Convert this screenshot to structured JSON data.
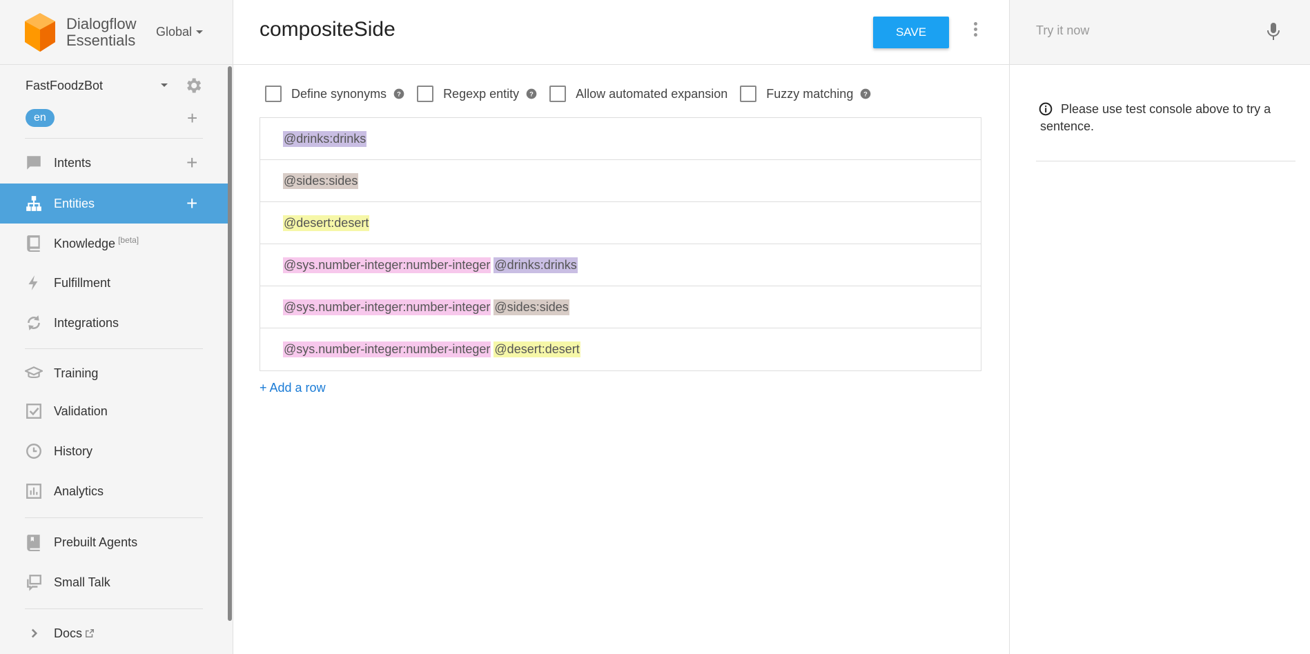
{
  "brand": {
    "line1": "Dialogflow",
    "line2": "Essentials",
    "region": "Global"
  },
  "agent": {
    "name": "FastFoodzBot",
    "language": "en"
  },
  "nav": {
    "intents": "Intents",
    "entities": "Entities",
    "knowledge": "Knowledge",
    "knowledge_tag": "[beta]",
    "fulfillment": "Fulfillment",
    "integrations": "Integrations",
    "training": "Training",
    "validation": "Validation",
    "history": "History",
    "analytics": "Analytics",
    "prebuilt": "Prebuilt Agents",
    "smalltalk": "Small Talk",
    "docs": "Docs"
  },
  "entity": {
    "name": "compositeSide",
    "save_label": "SAVE"
  },
  "options": {
    "define_synonyms": "Define synonyms",
    "regexp": "Regexp entity",
    "automated_expansion": "Allow automated expansion",
    "fuzzy": "Fuzzy matching"
  },
  "rows": [
    [
      {
        "text": "@drinks:drinks",
        "type": "drinks"
      }
    ],
    [
      {
        "text": "@sides:sides",
        "type": "sides"
      }
    ],
    [
      {
        "text": "@desert:desert",
        "type": "desert"
      }
    ],
    [
      {
        "text": "@sys.number-integer:number-integer",
        "type": "sys"
      },
      {
        "text": "@drinks:drinks",
        "type": "drinks"
      }
    ],
    [
      {
        "text": "@sys.number-integer:number-integer",
        "type": "sys"
      },
      {
        "text": "@sides:sides",
        "type": "sides"
      }
    ],
    [
      {
        "text": "@sys.number-integer:number-integer",
        "type": "sys"
      },
      {
        "text": "@desert:desert",
        "type": "desert"
      }
    ]
  ],
  "add_row_label": "+ Add a row",
  "console": {
    "placeholder": "Try it now",
    "hint": "Please use test console above to try a sentence."
  },
  "colors": {
    "accent": "#4ea3dc",
    "save": "#1ba1f2",
    "chip_drinks": "#c9bee3",
    "chip_sides": "#d8ccc6",
    "chip_desert": "#f6f7a8",
    "chip_sys": "#f7c8ec"
  },
  "icons": {
    "intents": "chat-bubble-icon",
    "entities": "hierarchy-icon",
    "knowledge": "book-icon",
    "fulfillment": "bolt-icon",
    "integrations": "sync-icon",
    "training": "graduation-cap-icon",
    "validation": "checkbox-icon",
    "history": "clock-icon",
    "analytics": "bar-chart-icon",
    "prebuilt": "bookmark-book-icon",
    "smalltalk": "chat-windows-icon",
    "docs": "external-link-icon",
    "mic": "microphone-icon",
    "info": "info-icon"
  }
}
